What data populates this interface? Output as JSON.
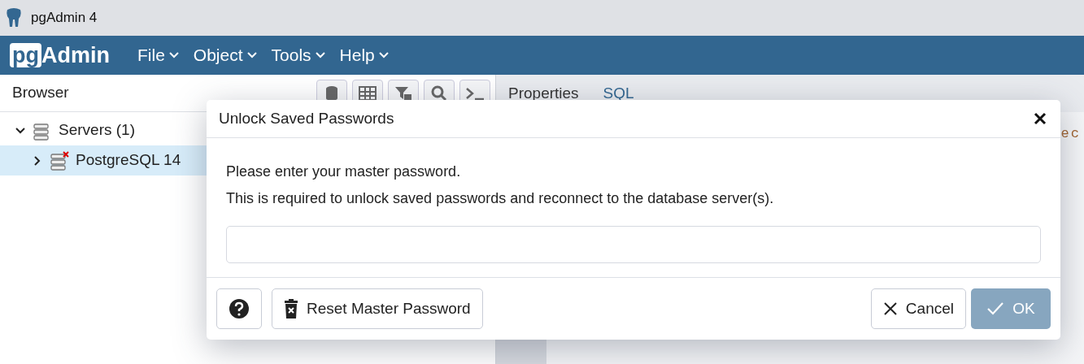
{
  "window": {
    "title": "pgAdmin 4"
  },
  "logo": {
    "boxed": "pg",
    "rest": "Admin"
  },
  "menu": [
    {
      "label": "File"
    },
    {
      "label": "Object"
    },
    {
      "label": "Tools"
    },
    {
      "label": "Help"
    }
  ],
  "browser": {
    "title": "Browser",
    "tree": [
      {
        "label": "Servers (1)",
        "expanded": true,
        "selected": false,
        "children": [
          {
            "label": "PostgreSQL 14",
            "expanded": false,
            "selected": true,
            "disconnected": true
          }
        ]
      }
    ]
  },
  "tabs": [
    {
      "label": "Properties",
      "selected": true
    },
    {
      "label": "SQL",
      "selected": false
    }
  ],
  "code_fragment": "ec",
  "dialog": {
    "title": "Unlock Saved Passwords",
    "message": [
      "Please enter your master password.",
      "This is required to unlock saved passwords and reconnect to the database server(s)."
    ],
    "buttons": [
      {
        "kind": "help",
        "disabled": false
      },
      {
        "kind": "reset",
        "label": "Reset Master Password",
        "disabled": false
      },
      {
        "kind": "cancel",
        "label": "Cancel",
        "disabled": false
      },
      {
        "kind": "ok",
        "label": "OK",
        "disabled": true
      }
    ]
  }
}
